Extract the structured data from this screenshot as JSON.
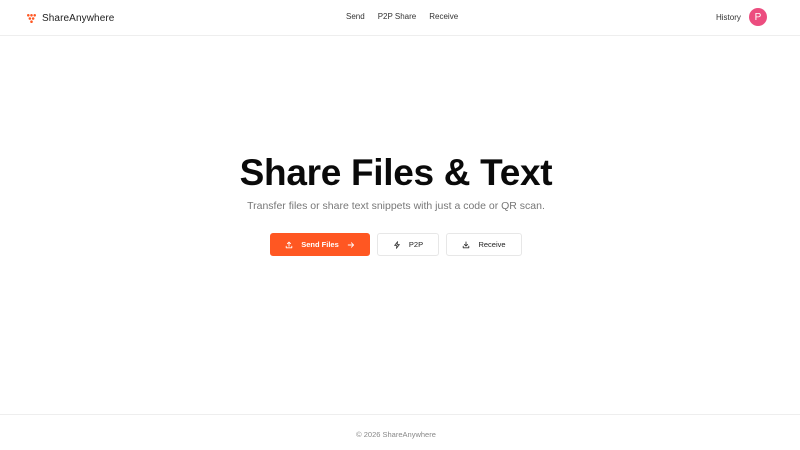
{
  "header": {
    "brand": {
      "name": "ShareAnywhere",
      "logo_icon": "heart-logo-icon",
      "logo_color": "#ff5722"
    },
    "nav": [
      {
        "label": "Send"
      },
      {
        "label": "P2P Share"
      },
      {
        "label": "Receive"
      }
    ],
    "history_label": "History",
    "avatar": {
      "initial": "P",
      "color": "#ec4d7f"
    }
  },
  "hero": {
    "title": "Share Files & Text",
    "subtitle": "Transfer files or share text snippets with just a code or QR scan."
  },
  "actions": {
    "send": {
      "label": "Send Files",
      "icon": "upload-icon",
      "trailing_icon": "arrow-right-icon",
      "color": "#ff5722"
    },
    "p2p": {
      "label": "P2P",
      "icon": "lightning-icon"
    },
    "receive": {
      "label": "Receive",
      "icon": "download-icon"
    }
  },
  "footer": {
    "text": "© 2026 ShareAnywhere"
  }
}
